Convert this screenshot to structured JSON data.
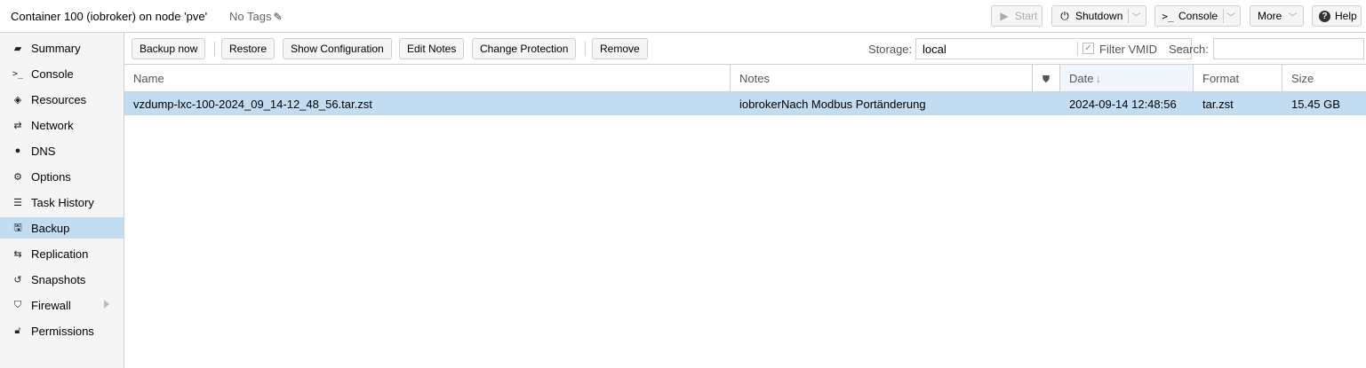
{
  "header": {
    "title": "Container 100 (iobroker) on node 'pve'",
    "tags": "No Tags",
    "buttons": {
      "start": "Start",
      "shutdown": "Shutdown",
      "console": "Console",
      "more": "More",
      "help": "Help"
    }
  },
  "sidebar": {
    "items": [
      {
        "label": "Summary",
        "icon": "book-icon"
      },
      {
        "label": "Console",
        "icon": "terminal-icon"
      },
      {
        "label": "Resources",
        "icon": "cube-icon"
      },
      {
        "label": "Network",
        "icon": "exchange-icon"
      },
      {
        "label": "DNS",
        "icon": "globe-icon"
      },
      {
        "label": "Options",
        "icon": "gear-icon"
      },
      {
        "label": "Task History",
        "icon": "list-icon"
      },
      {
        "label": "Backup",
        "icon": "floppy-icon"
      },
      {
        "label": "Replication",
        "icon": "retweet-icon"
      },
      {
        "label": "Snapshots",
        "icon": "history-icon"
      },
      {
        "label": "Firewall",
        "icon": "shield-icon"
      },
      {
        "label": "Permissions",
        "icon": "unlock-icon"
      }
    ],
    "active": "Backup"
  },
  "toolbar": {
    "backup_now": "Backup now",
    "restore": "Restore",
    "show_configuration": "Show Configuration",
    "edit_notes": "Edit Notes",
    "change_protection": "Change Protection",
    "remove": "Remove",
    "storage_label": "Storage:",
    "storage_value": "local",
    "filter_vmid": "Filter VMID",
    "filter_vmid_checked": true,
    "search_label": "Search:",
    "search_value": ""
  },
  "grid": {
    "columns": {
      "name": "Name",
      "notes": "Notes",
      "date": "Date",
      "format": "Format",
      "size": "Size"
    },
    "rows": [
      {
        "name": "vzdump-lxc-100-2024_09_14-12_48_56.tar.zst",
        "notes": "iobrokerNach Modbus Portänderung",
        "date": "2024-09-14 12:48:56",
        "format": "tar.zst",
        "size": "15.45 GB",
        "selected": true
      }
    ]
  },
  "colors": {
    "selection": "#c2ddf2",
    "sidebar_bg": "#f5f5f5",
    "border": "#cfcfcf"
  }
}
